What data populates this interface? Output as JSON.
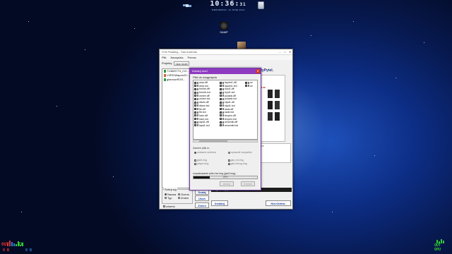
{
  "desktop": {
    "clock": {
      "time": "10:36:",
      "seconds": "31",
      "date": "WEDNESDAY, 12 JUNE 2013"
    },
    "icons": [
      {
        "name": "satellite-icon"
      },
      {
        "name": "samp-icon",
        "label": "SAMP"
      },
      {
        "name": "recycle-bin-icon"
      },
      {
        "name": "user-avatar-icon"
      }
    ],
    "network": {
      "out_label": "OUT",
      "in_label": "IN",
      "out_value": "0 B",
      "in_value": "0 B",
      "right_out_label": "OUT",
      "right_in_label": "OPU"
    }
  },
  "app": {
    "title": "GTA Padding - San Andreas",
    "menu": [
      "Plik",
      "Narzędzia",
      "Pomoc"
    ],
    "toolbar": {
      "label": "Projekty",
      "combo_value": "new mobi"
    },
    "list_items": [
      "713820774_CO...",
      "LSPD\\Wapon20...",
      "glamoorRGS..."
    ],
    "right_title": "...llyPytel.",
    "preview_text": "sk w",
    "preview_caption": "pL 15",
    "buttons": {
      "add": "Dodaj",
      "remove": "Usuń",
      "change": "Zmień",
      "install": "Instaluj",
      "about": "Hot.Oldest."
    },
    "status_text": "Wyjdź: z gry",
    "sort": {
      "title": "Sortuj wg",
      "options": [
        "Nazwa",
        "Typ",
        "Ocena",
        "Zmień"
      ],
      "selected": "Nazwa",
      "checkbox_label": "odwróć"
    }
  },
  "dialog": {
    "title": "Instaluj mod",
    "files_label": "Pliki do ściągnięcia",
    "files": [
      [
        "amp.dff",
        "amp.txd",
        "bmmb.dff",
        "bmmb.txd",
        "cshee.dff",
        "cshee.txd",
        "dlsee.dff",
        "dlsee.txd",
        "fbi.dff",
        "fbi.txd",
        "harn.dff",
        "harn.txd",
        "lapd1.dff",
        "lapd1.txd"
      ],
      [
        "lapdm1.dff",
        "lapdm1.txd",
        "lvpd1.dff",
        "lvpd1.txd",
        "pulaski.dff",
        "pulaski.txd",
        "sfpd1.dff",
        "sfpd1.txd",
        "swat.dff",
        "swat.txd",
        "tenpen.dff",
        "tenpen.txd",
        "wmomib.dff",
        "wmomib.txd"
      ],
      [
        "wr",
        "wr",
        "",
        "",
        "",
        "",
        "",
        "",
        "",
        "",
        "",
        "",
        "",
        ""
      ]
    ],
    "replace_label": "Zamień pliki w:",
    "replace_options": [
      "ustawne archiwa",
      "sprawdź wszystkie",
      "gta3.img",
      "player.img",
      "gta_int.img",
      "gta.cheng.img"
    ],
    "progress_label": "rozpakowanie pliku bvr.img (gta3.img)...",
    "progress": 0.25,
    "progress_text": "25%",
    "buttons": [
      "Anuluj",
      "Gotowe"
    ]
  }
}
